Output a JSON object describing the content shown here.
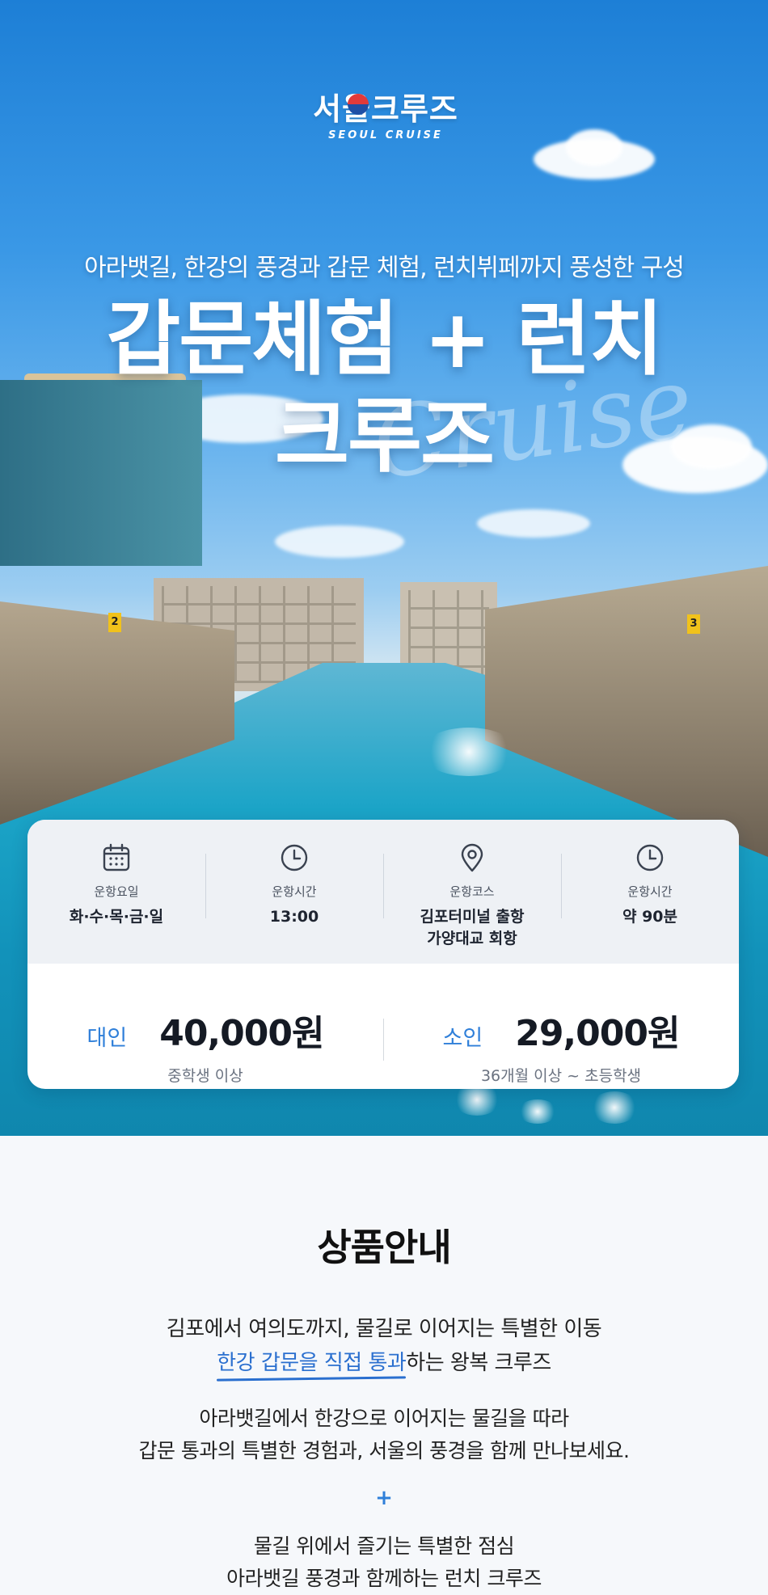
{
  "brand": {
    "logo_ko": "서울크루즈",
    "logo_en": "SEOUL CRUISE"
  },
  "hero": {
    "subtitle": "아라뱃길, 한강의 풍경과  갑문 체험, 런치뷔페까지 풍성한 구성",
    "title_line1": "갑문체험 + 런치",
    "title_line2": "크루즈",
    "script_text": "Cruise"
  },
  "info": [
    {
      "icon": "calendar-icon",
      "label": "운항요일",
      "value": "화·수·목·금·일"
    },
    {
      "icon": "clock-icon",
      "label": "운항시간",
      "value": "13:00"
    },
    {
      "icon": "map-pin-icon",
      "label": "운항코스",
      "value": "김포터미널 출항\n가양대교 회항"
    },
    {
      "icon": "clock-icon",
      "label": "운항시간",
      "value": "약 90분"
    }
  ],
  "prices": [
    {
      "label": "대인",
      "value": "40,000원",
      "note": "중학생 이상"
    },
    {
      "label": "소인",
      "value": "29,000원",
      "note": "36개월 이상 ~ 초등학생"
    }
  ],
  "product": {
    "title": "상품안내",
    "line1": "김포에서 여의도까지, 물길로 이어지는 특별한 이동",
    "line2_highlight": "한강 갑문을 직접 통과",
    "line2_rest": "하는 왕복 크루즈",
    "line3a": "아라뱃길에서 한강으로 이어지는 물길을 따라",
    "line3b": "갑문 통과의 특별한 경험과, 서울의 풍경을 함께 만나보세요.",
    "plus": "+",
    "line4a": "물길 위에서 즐기는 특별한 점심",
    "line4b": "아라뱃길 풍경과 함께하는 런치 크루즈"
  },
  "colors": {
    "accent": "#2f7fd9",
    "card_top_bg": "#eef1f5",
    "highlight_bar": "#b7d4f6"
  }
}
